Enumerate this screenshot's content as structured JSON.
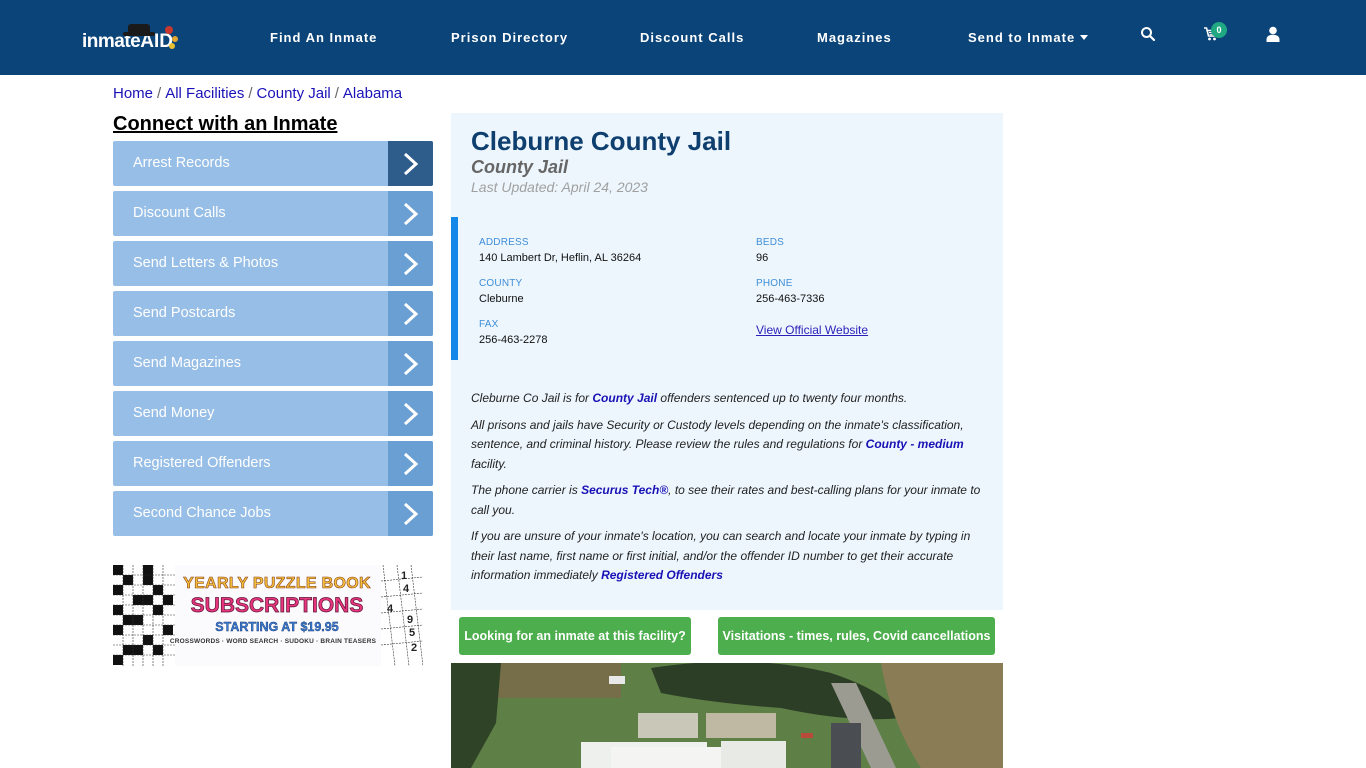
{
  "nav": {
    "logo_text": "inmate",
    "logo_accent": "AID",
    "links": [
      "Find An Inmate",
      "Prison Directory",
      "Discount Calls",
      "Magazines",
      "Send to Inmate"
    ],
    "cart_count": "0",
    "icons": {
      "search": "search-icon",
      "cart": "cart-icon",
      "user": "user-icon",
      "dropdown": "caret-down-icon"
    }
  },
  "breadcrumb": [
    "Home",
    "All Facilities",
    "County Jail",
    "Alabama"
  ],
  "sidebar": {
    "heading": "Connect with an Inmate",
    "items": [
      {
        "label": "Arrest Records"
      },
      {
        "label": "Discount Calls"
      },
      {
        "label": "Send Letters & Photos"
      },
      {
        "label": "Send Postcards"
      },
      {
        "label": "Send Magazines"
      },
      {
        "label": "Send Money"
      },
      {
        "label": "Registered Offenders"
      },
      {
        "label": "Second Chance Jobs"
      }
    ]
  },
  "ad": {
    "line1": "YEARLY PUZZLE BOOK",
    "line2": "SUBSCRIPTIONS",
    "line3": "STARTING AT $19.95",
    "line4": "CROSSWORDS · WORD SEARCH · SUDOKU · BRAIN TEASERS",
    "sudoku_digits": [
      "1",
      "4",
      "4",
      "9",
      "5",
      "2"
    ]
  },
  "facility": {
    "name": "Cleburne County Jail",
    "type": "County Jail",
    "last_updated": "Last Updated: April 24, 2023",
    "fields": {
      "address_label": "ADDRESS",
      "address": "140 Lambert Dr, Heflin, AL 36264",
      "beds_label": "BEDS",
      "beds": "96",
      "county_label": "COUNTY",
      "county": "Cleburne",
      "phone_label": "PHONE",
      "phone": "256-463-7336",
      "fax_label": "FAX",
      "fax": "256-463-2278",
      "website_link": "View Official Website"
    },
    "description": {
      "p1_a": "Cleburne Co Jail is for ",
      "p1_link": "County Jail",
      "p1_b": " offenders sentenced up to twenty four months.",
      "p2_a": "All prisons and jails have Security or Custody levels depending on the inmate's classification, sentence, and criminal history. Please review the rules and regulations for ",
      "p2_link": "County - medium",
      "p2_b": " facility.",
      "p3_a": "The phone carrier is ",
      "p3_link": "Securus Tech®",
      "p3_b": ", to see their rates and best-calling plans for your inmate to call you.",
      "p4_a": "If you are unsure of your inmate's location, you can search and locate your inmate by typing in their last name, first name or first initial, and/or the offender ID number to get their accurate information immediately ",
      "p4_link": "Registered Offenders"
    }
  },
  "buttons": {
    "find_inmate": "Looking for an inmate at this facility?",
    "visitations": "Visitations - times, rules, Covid cancellations"
  },
  "colors": {
    "nav_bg": "#0b4479",
    "sidebar_item": "#97bee6",
    "sidebar_arrow": "#6a9fd3",
    "sidebar_arrow_active": "#2e5d8c",
    "panel_bg": "#edf6fd",
    "accent_bar": "#1289e8",
    "green_button": "#4cae4c",
    "title": "#0e3f6f"
  }
}
